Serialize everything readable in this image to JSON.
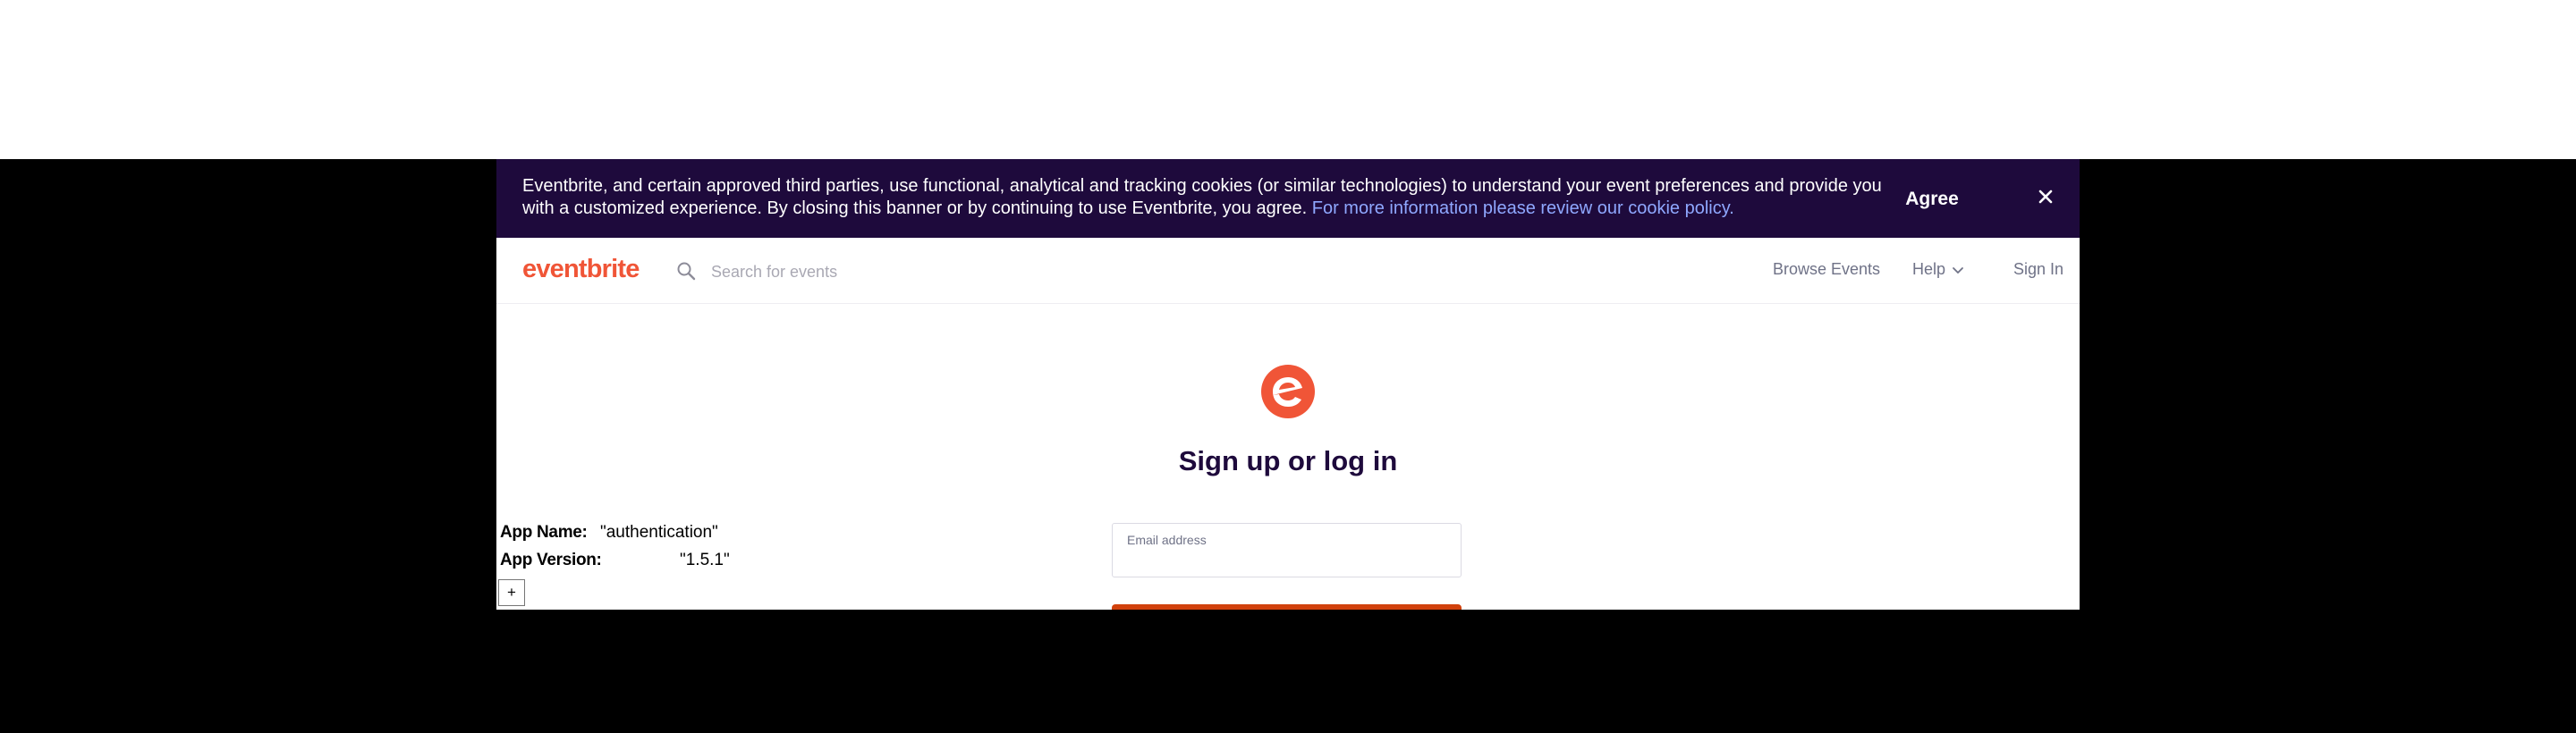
{
  "cookie_banner": {
    "text": "Eventbrite, and certain approved third parties, use functional, analytical and tracking cookies (or similar technologies) to understand your event preferences and provide you with a customized experience. By closing this banner or by continuing to use Eventbrite, you agree.",
    "link_text": "For more information please review our cookie policy.",
    "agree_label": "Agree",
    "close_icon": "close-icon"
  },
  "header": {
    "logo": "eventbrite",
    "search_placeholder": "Search for events",
    "nav": {
      "browse": "Browse Events",
      "help": "Help",
      "signin": "Sign In"
    }
  },
  "main": {
    "title": "Sign up or log in",
    "email_label": "Email address",
    "email_value": ""
  },
  "app_info": {
    "name_key": "App Name:",
    "name_value": "\"authentication\"",
    "version_key": "App Version:",
    "version_value": "\"1.5.1\"",
    "expand_label": "+"
  },
  "colors": {
    "brand": "#f05537",
    "banner_bg": "#1e0a3c",
    "link": "#8fa8ff",
    "button": "#d1410c"
  }
}
